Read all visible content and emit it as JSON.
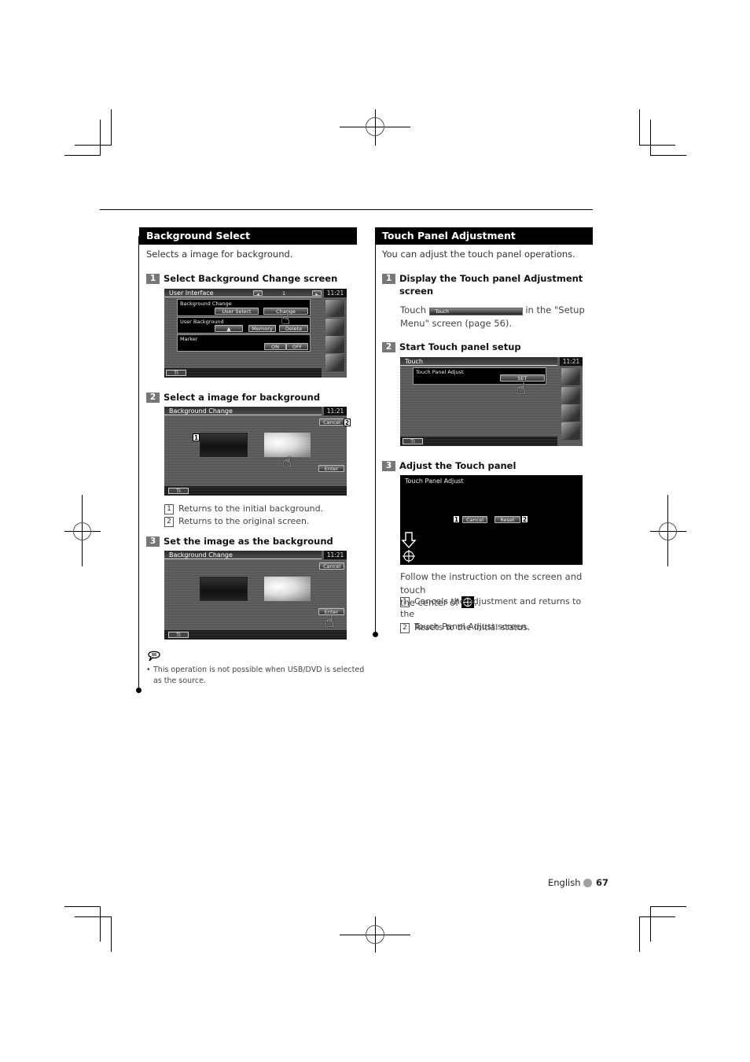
{
  "left_section": {
    "title": "Background Select",
    "intro": "Selects a image for background.",
    "steps": [
      {
        "num": "1",
        "title": "Select Background Change screen"
      },
      {
        "num": "2",
        "title": "Select a image for background"
      },
      {
        "num": "3",
        "title": "Set the image as the background"
      }
    ],
    "step2_notes": [
      {
        "num": "1",
        "text": "Returns to the initial background."
      },
      {
        "num": "2",
        "text": "Returns to the original screen."
      }
    ],
    "note": {
      "icon": "note-icon",
      "bullet": "•",
      "line1": "This operation is not possible when USB/DVD is selected",
      "line2": "as the source."
    },
    "screen1": {
      "title": "User Interface",
      "page": "1",
      "clock": "11:21",
      "rows": [
        {
          "label": "Background Change",
          "buttons": [
            "User Select",
            "Change"
          ]
        },
        {
          "label": "User Background",
          "buttons": [
            "▲",
            "Memory",
            "Delete"
          ]
        },
        {
          "label": "Marker",
          "buttons": [
            "ON",
            "OFF"
          ]
        }
      ],
      "ti": "TI"
    },
    "screen2": {
      "title": "Background Change",
      "clock": "11:21",
      "cancel": "Cancel",
      "enter": "Enter",
      "ti": "TI",
      "callouts": [
        "1",
        "2"
      ]
    },
    "screen3": {
      "title": "Background Change",
      "clock": "11:21",
      "cancel": "Cancel",
      "enter": "Enter",
      "ti": "TI"
    }
  },
  "right_section": {
    "title": "Touch Panel Adjustment",
    "intro": "You can adjust the touch panel operations.",
    "steps": [
      {
        "num": "1",
        "title_line1": "Display the Touch panel Adjustment",
        "title_line2": "screen"
      },
      {
        "num": "2",
        "title": "Start Touch panel setup"
      },
      {
        "num": "3",
        "title": "Adjust the Touch panel"
      }
    ],
    "step1_body": {
      "prefix": "Touch",
      "button_label": "Touch",
      "suffix": "in the \"Setup",
      "line2": "Menu\" screen (page 56)."
    },
    "screen_touch": {
      "title": "Touch",
      "clock": "11:21",
      "row_label": "Touch Panel Adjust",
      "set": "SET",
      "ti": "TI"
    },
    "screen_adjust": {
      "title": "Touch Panel Adjust",
      "cancel": "Cancel",
      "reset": "Reset",
      "callouts": [
        "1",
        "2"
      ]
    },
    "step3_body": {
      "line1": "Follow the instruction on the screen and touch",
      "line2": "the center of",
      "suffix": "."
    },
    "step3_notes": [
      {
        "num": "1",
        "line1": "Cancels the adjustment and returns to the",
        "line2": "Touch Panel Adjust screen."
      },
      {
        "num": "2",
        "line1": "Resets to the initial status."
      }
    ]
  },
  "footer": {
    "language": "English",
    "page": "67",
    "dot_color": "#a0a0a0"
  }
}
